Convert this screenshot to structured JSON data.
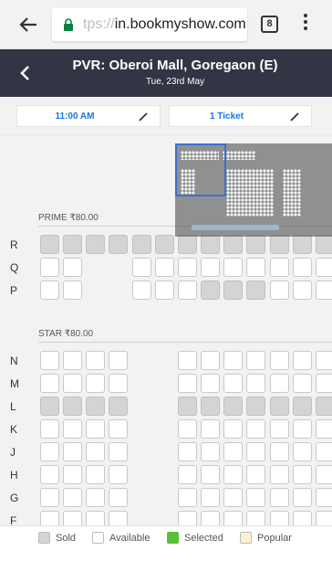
{
  "browser": {
    "url_faded": "tps://",
    "url_main": "in.bookmyshow.com",
    "tab_count": "8"
  },
  "header": {
    "title": "PVR: Oberoi Mall, Goregaon (E)",
    "subtitle": "Tue, 23rd May"
  },
  "selectors": {
    "time": "11:00 AM",
    "tickets": "1 Ticket"
  },
  "categories": [
    {
      "label": "PRIME ₹80.00"
    },
    {
      "label": "STAR ₹80.00"
    }
  ],
  "rows": {
    "R": "R",
    "Q": "Q",
    "P": "P",
    "N": "N",
    "M": "M",
    "L": "L",
    "K": "K",
    "J": "J",
    "H": "H",
    "G": "G",
    "F": "F"
  },
  "legend": {
    "sold": "Sold",
    "available": "Available",
    "selected": "Selected",
    "popular": "Popular",
    "colors": {
      "sold": "#d4d4d4",
      "available": "#ffffff",
      "selected": "#5bbf3a",
      "popular": "#fbf3d0"
    }
  }
}
